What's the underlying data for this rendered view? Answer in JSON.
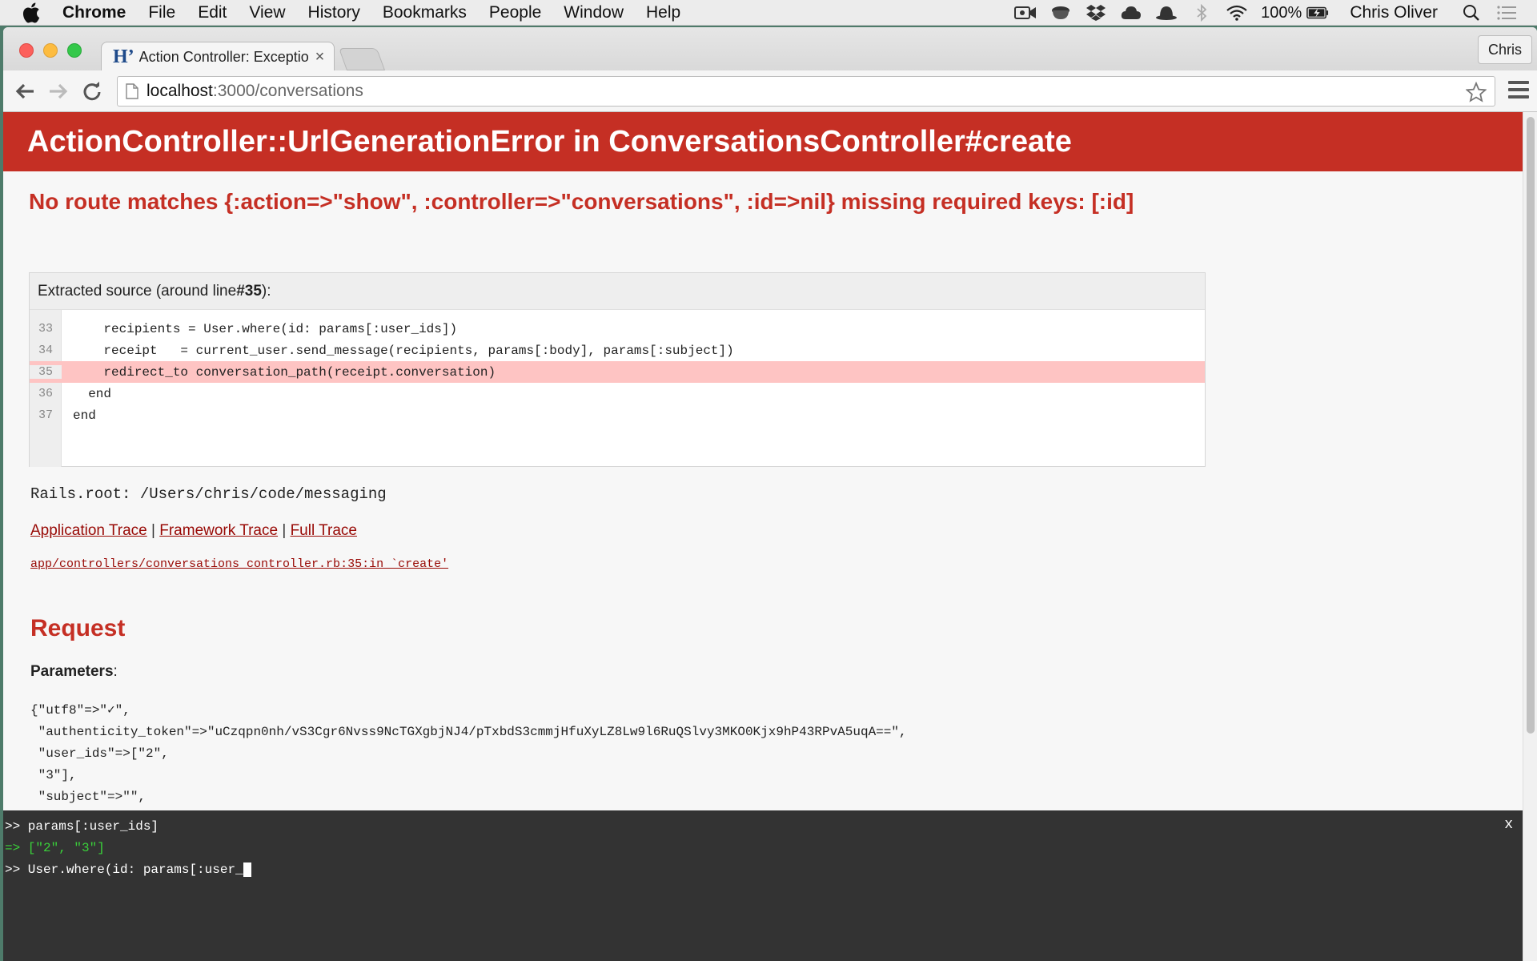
{
  "menubar": {
    "app": "Chrome",
    "items": [
      "File",
      "Edit",
      "View",
      "History",
      "Bookmarks",
      "People",
      "Window",
      "Help"
    ],
    "battery": "100%",
    "user": "Chris Oliver"
  },
  "browser": {
    "tab_title": "Action Controller: Exception caught",
    "profile": "Chris",
    "url_host": "localhost",
    "url_path": ":3000/conversations"
  },
  "page": {
    "header": "ActionController::UrlGenerationError in ConversationsController#create",
    "message": "No route matches {:action=>\"show\", :controller=>\"conversations\", :id=>nil} missing required keys: [:id]",
    "source_head_prefix": "Extracted source (around line ",
    "source_head_line": "#35",
    "source_head_suffix": "):",
    "source_lines": [
      {
        "num": "33",
        "code": "    recipients = User.where(id: params[:user_ids])"
      },
      {
        "num": "34",
        "code": "    receipt   = current_user.send_message(recipients, params[:body], params[:subject])"
      },
      {
        "num": "35",
        "code": "    redirect_to conversation_path(receipt.conversation)"
      },
      {
        "num": "36",
        "code": "  end"
      },
      {
        "num": "37",
        "code": "end"
      }
    ],
    "rails_root": "Rails.root: /Users/chris/code/messaging",
    "trace_links": {
      "application": "Application Trace",
      "framework": "Framework Trace",
      "full": "Full Trace",
      "separator": " | "
    },
    "trace_file": "app/controllers/conversations_controller.rb:35:in `create'",
    "request_heading": "Request",
    "params_label": "Parameters",
    "params_colon": ":",
    "params_lines": [
      "{\"utf8\"=>\"✓\",",
      " \"authenticity_token\"=>\"uCzqpn0nh/vS3Cgr6Nvss9NcTGXgbjNJ4/pTxbdS3cmmjHfuXyLZ8Lw9l6RuQSlvy3MKO0Kjx9hP43RPvA5uqA==\",",
      " \"user_ids\"=>[\"2\",",
      " \"3\"],",
      " \"subject\"=>\"\","
    ]
  },
  "console": {
    "lines": [
      {
        "text": ">> params[:user_ids]",
        "type": "input"
      },
      {
        "text": "=> [\"2\", \"3\"]",
        "type": "result"
      },
      {
        "text": ">> User.where(id: params[:user_",
        "type": "input"
      }
    ],
    "close": "x"
  }
}
